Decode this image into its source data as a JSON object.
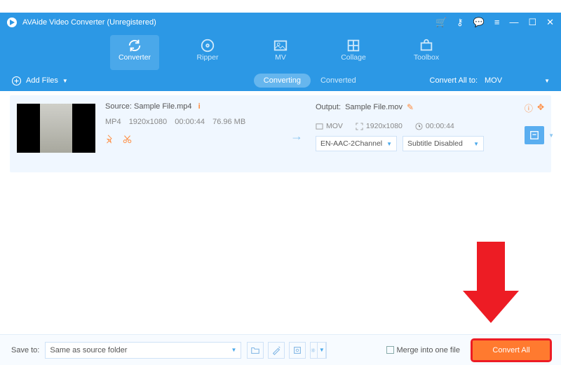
{
  "titlebar": {
    "title": "AVAide Video Converter (Unregistered)"
  },
  "nav": {
    "converter": "Converter",
    "ripper": "Ripper",
    "mv": "MV",
    "collage": "Collage",
    "toolbox": "Toolbox"
  },
  "toolbar": {
    "add_files": "Add Files",
    "tabs": {
      "converting": "Converting",
      "converted": "Converted"
    },
    "convert_all_to": "Convert All to:",
    "convert_all_format": "MOV"
  },
  "file": {
    "source_label": "Source:",
    "source_name": "Sample File.mp4",
    "format": "MP4",
    "resolution": "1920x1080",
    "duration": "00:00:44",
    "size": "76.96 MB",
    "output_label": "Output:",
    "output_name": "Sample File.mov",
    "out_format": "MOV",
    "out_resolution": "1920x1080",
    "out_duration": "00:00:44",
    "audio": "EN-AAC-2Channel",
    "subtitle": "Subtitle Disabled"
  },
  "footer": {
    "save_to_label": "Save to:",
    "save_to_value": "Same as source folder",
    "merge_label": "Merge into one file",
    "convert_all": "Convert All"
  }
}
